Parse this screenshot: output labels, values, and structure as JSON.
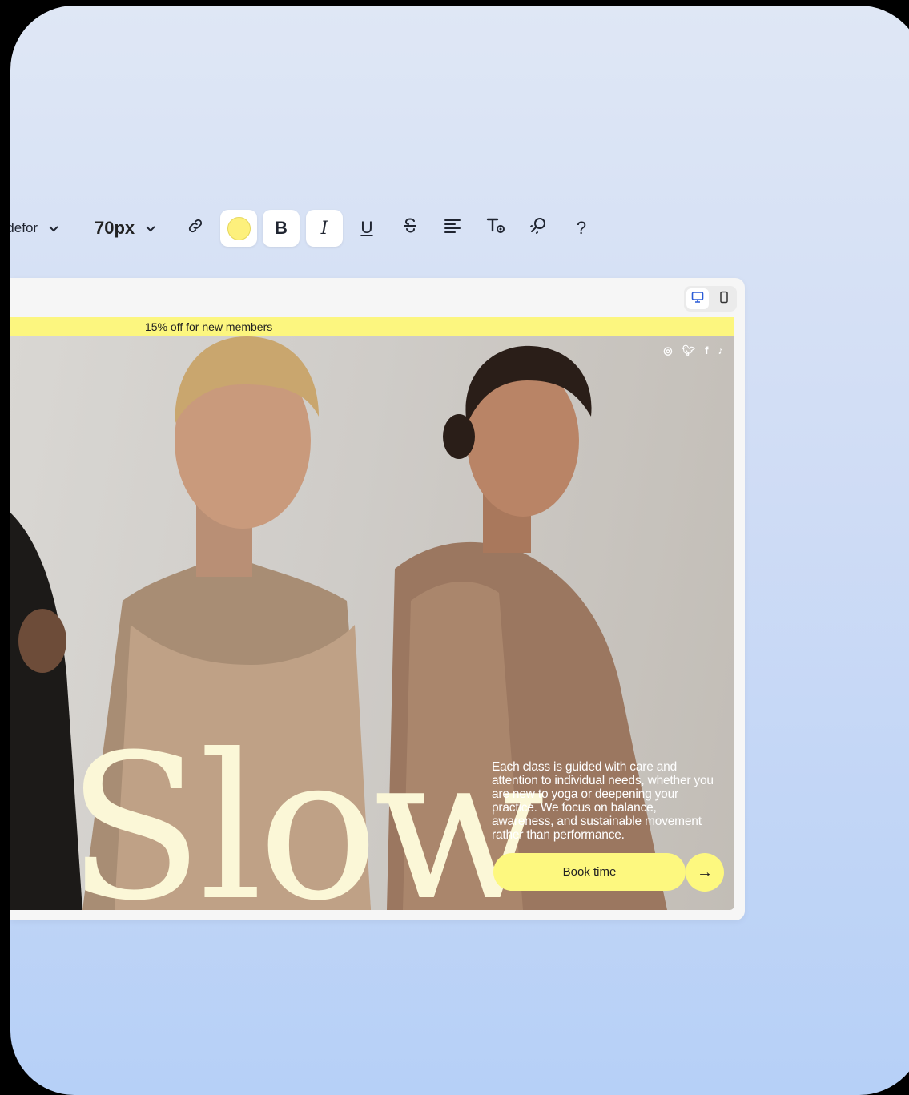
{
  "toolbar": {
    "font_family": "Tildefor",
    "font_size": "70px",
    "text_color": "#fdf07c",
    "icons": [
      "link-icon",
      "color-swatch",
      "bold-icon",
      "italic-icon",
      "underline-icon",
      "strikethrough-icon",
      "align-left-icon",
      "text-settings-icon",
      "ai-magic-icon",
      "help-icon"
    ],
    "bold_label": "B",
    "italic_label": "I",
    "underline_label": "U",
    "help_label": "?"
  },
  "preview": {
    "device_modes": [
      "desktop",
      "mobile"
    ],
    "active_device": "desktop",
    "promo_text": "15% off for new members",
    "social": [
      "instagram",
      "twitter",
      "facebook",
      "tiktok"
    ],
    "hero_word": "Slow",
    "hero_desc": "Each class is guided with care and attention to individual needs, whether you are new to yoga or deepening your practice. We focus on balance, awareness, and sustainable movement rather than performance.",
    "cta_label": "Book time",
    "cta_arrow": "→",
    "accent": "#fdf87f"
  }
}
